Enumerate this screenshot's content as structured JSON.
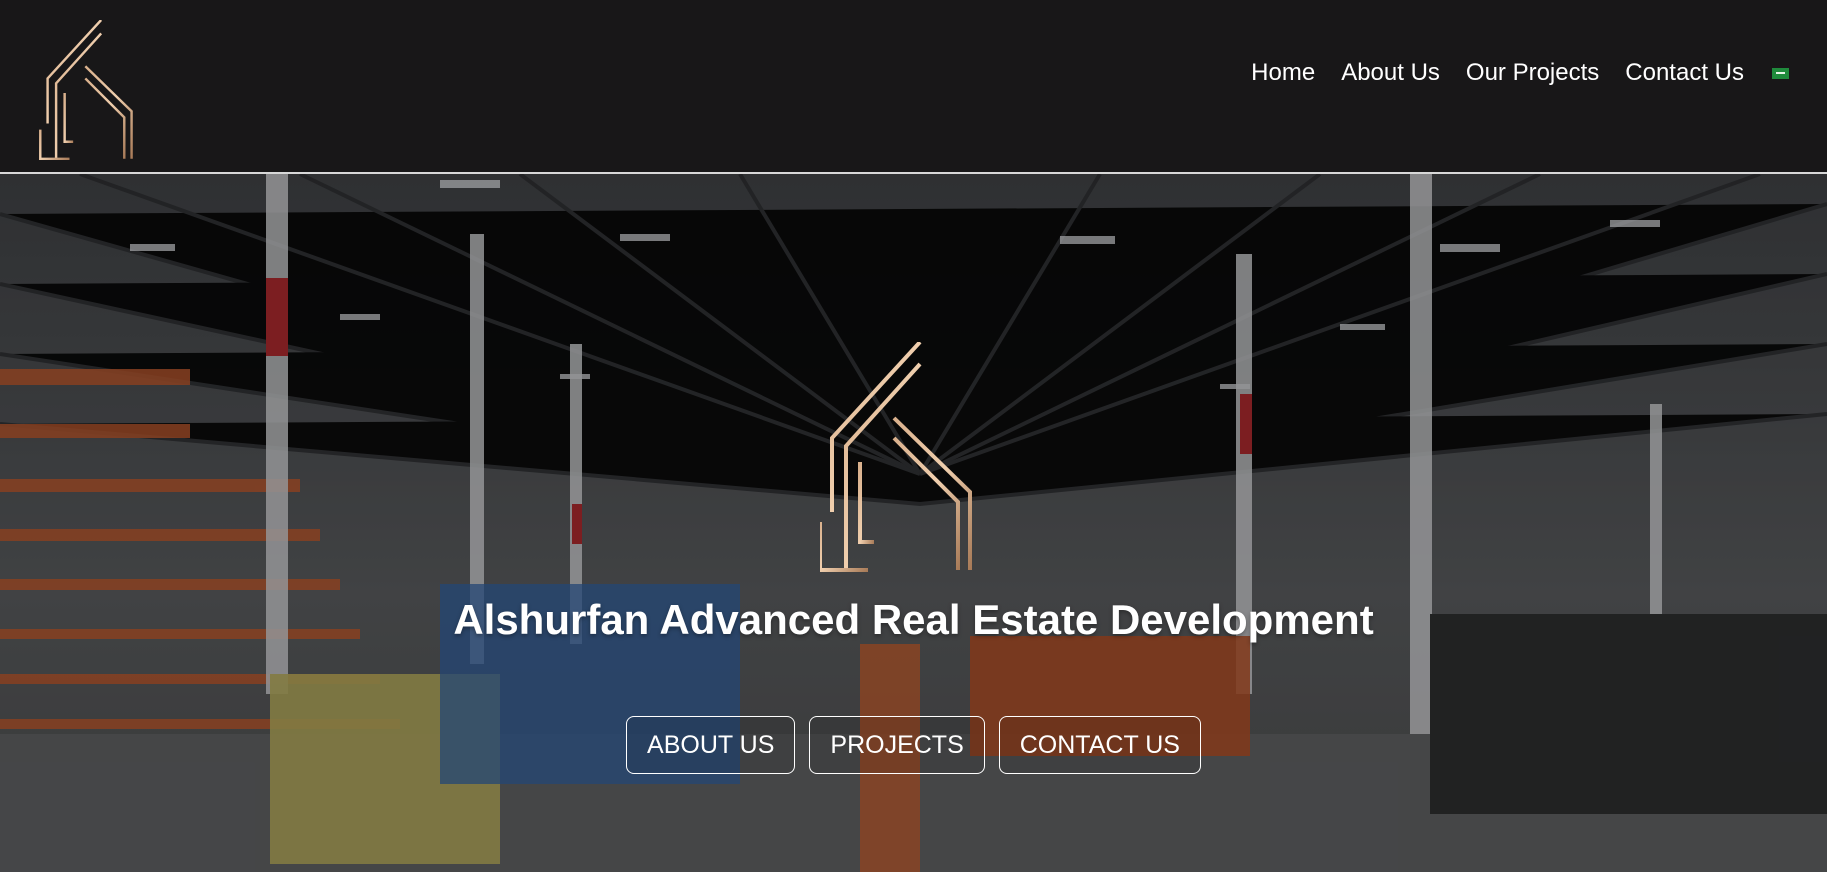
{
  "brand": {
    "logo_icon": "building-logo-icon",
    "accent_color": "#c8a07e"
  },
  "nav": {
    "items": [
      {
        "label": "Home"
      },
      {
        "label": "About Us"
      },
      {
        "label": "Our Projects"
      },
      {
        "label": "Contact Us"
      }
    ],
    "language_icon": "saudi-flag-icon"
  },
  "hero": {
    "title": "Alshurfan Advanced Real Estate Development",
    "buttons": [
      {
        "label": "ABOUT US"
      },
      {
        "label": "PROJECTS"
      },
      {
        "label": "CONTACT US"
      }
    ],
    "background": "warehouse-construction-photo"
  }
}
